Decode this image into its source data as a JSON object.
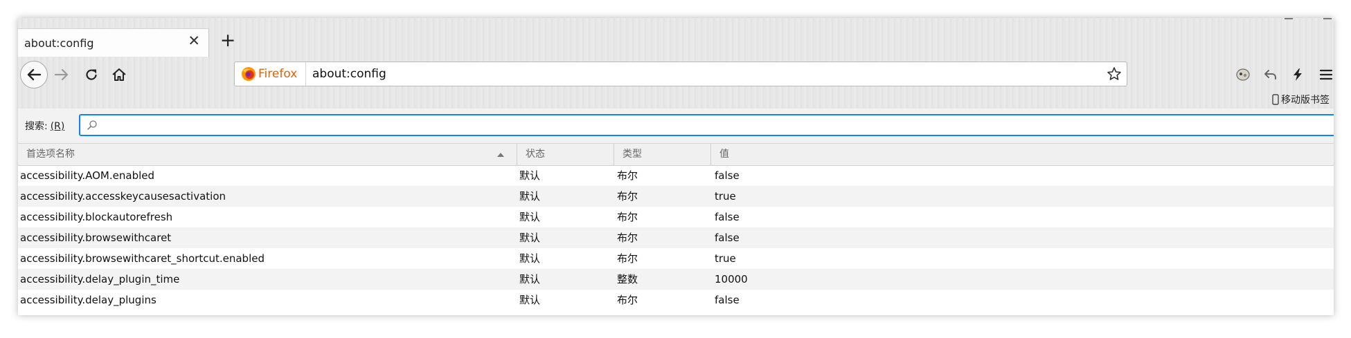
{
  "tab": {
    "title": "about:config"
  },
  "urlbar": {
    "identity": "Firefox",
    "url": "about:config"
  },
  "bookmarks": {
    "mobile": "移动版书签"
  },
  "search": {
    "label": "搜索:",
    "accesskey": "(R)",
    "placeholder": "",
    "value": ""
  },
  "columns": [
    "首选项名称",
    "状态",
    "类型",
    "值"
  ],
  "rows": [
    {
      "name": "accessibility.AOM.enabled",
      "status": "默认",
      "type": "布尔",
      "value": "false"
    },
    {
      "name": "accessibility.accesskeycausesactivation",
      "status": "默认",
      "type": "布尔",
      "value": "true"
    },
    {
      "name": "accessibility.blockautorefresh",
      "status": "默认",
      "type": "布尔",
      "value": "false"
    },
    {
      "name": "accessibility.browsewithcaret",
      "status": "默认",
      "type": "布尔",
      "value": "false"
    },
    {
      "name": "accessibility.browsewithcaret_shortcut.enabled",
      "status": "默认",
      "type": "布尔",
      "value": "true"
    },
    {
      "name": "accessibility.delay_plugin_time",
      "status": "默认",
      "type": "整数",
      "value": "10000"
    },
    {
      "name": "accessibility.delay_plugins",
      "status": "默认",
      "type": "布尔",
      "value": "false"
    }
  ],
  "colors": {
    "accent": "#0a84ff",
    "firefox_orange": "#e66000"
  }
}
